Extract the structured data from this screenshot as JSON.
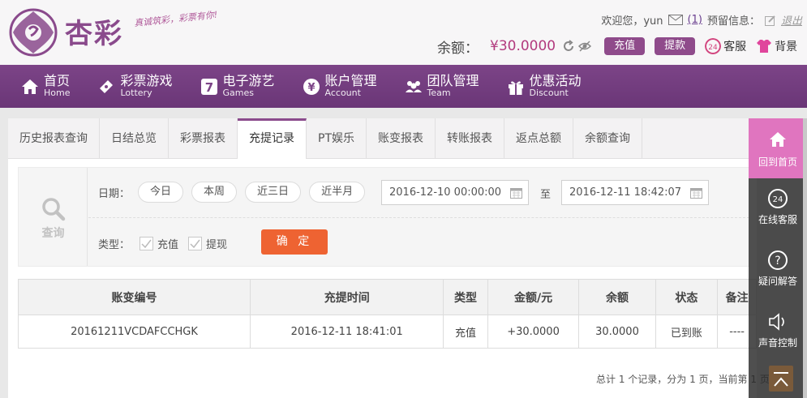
{
  "header": {
    "brand": "杏彩",
    "slogan": "真诚筑彩，彩票有你!",
    "welcome": "欢迎您，yun",
    "msg_count": "(1)",
    "reserve_label": "预留信息：",
    "logout": "退出",
    "balance_label": "余额：",
    "balance_value": "¥30.0000",
    "deposit_label": "充值",
    "withdraw_label": "提款",
    "service_label": "客服",
    "background_label": "背景"
  },
  "nav": [
    {
      "cn": "首页",
      "en": "Home",
      "icon": "home-icon"
    },
    {
      "cn": "彩票游戏",
      "en": "Lottery",
      "icon": "ticket-icon"
    },
    {
      "cn": "电子游艺",
      "en": "Games",
      "icon": "seven-icon"
    },
    {
      "cn": "账户管理",
      "en": "Account",
      "icon": "yen-icon"
    },
    {
      "cn": "团队管理",
      "en": "Team",
      "icon": "team-icon"
    },
    {
      "cn": "优惠活动",
      "en": "Discount",
      "icon": "gift-icon"
    }
  ],
  "tabs": [
    "历史报表查询",
    "日结总览",
    "彩票报表",
    "充提记录",
    "PT娱乐",
    "账变报表",
    "转账报表",
    "返点总额",
    "余额查询"
  ],
  "active_tab": 3,
  "filter": {
    "query_label": "查询",
    "date_label": "日期：",
    "quick_dates": [
      "今日",
      "本周",
      "近三日",
      "近半月"
    ],
    "start_date": "2016-12-10 00:00:00",
    "to_label": "至",
    "end_date": "2016-12-11 18:42:07",
    "type_label": "类型：",
    "type_options": [
      "充值",
      "提现"
    ],
    "confirm_label": "确 定"
  },
  "table": {
    "headers": [
      "账变编号",
      "充提时间",
      "类型",
      "金额/元",
      "余额",
      "状态",
      "备注"
    ],
    "rows": [
      [
        "20161211VCDAFCCHGK",
        "2016-12-11 18:41:01",
        "充值",
        "+30.0000",
        "30.0000",
        "已到账",
        "----"
      ]
    ],
    "footer": "总计 1 个记录，分为 1 页，当前第 1 页"
  },
  "sidebar": {
    "home": "回到首页",
    "service": "在线客服",
    "faq": "疑问解答",
    "sound": "声音控制"
  },
  "colors": {
    "brand_purple": "#7c4487",
    "accent_orange": "#ee6332",
    "sidebar_pink": "#e075bf",
    "amount_red": "#c0392b",
    "status_green": "#2ea03a"
  }
}
